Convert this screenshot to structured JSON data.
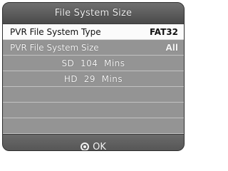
{
  "dialog": {
    "title": "File System Size"
  },
  "rows": {
    "fs_type": {
      "label": "PVR File System Type",
      "value": "FAT32"
    },
    "fs_size": {
      "label": "PVR File System Size",
      "value": "All"
    },
    "sd_info": "SD  104  Mins",
    "hd_info": "HD  29  Mins"
  },
  "footer": {
    "ok_icon": "ok-circle-icon",
    "ok_label": "OK"
  },
  "colors": {
    "selected_row": "#fbfbfb",
    "row": "#949494",
    "frame": "#5e5e5e"
  }
}
